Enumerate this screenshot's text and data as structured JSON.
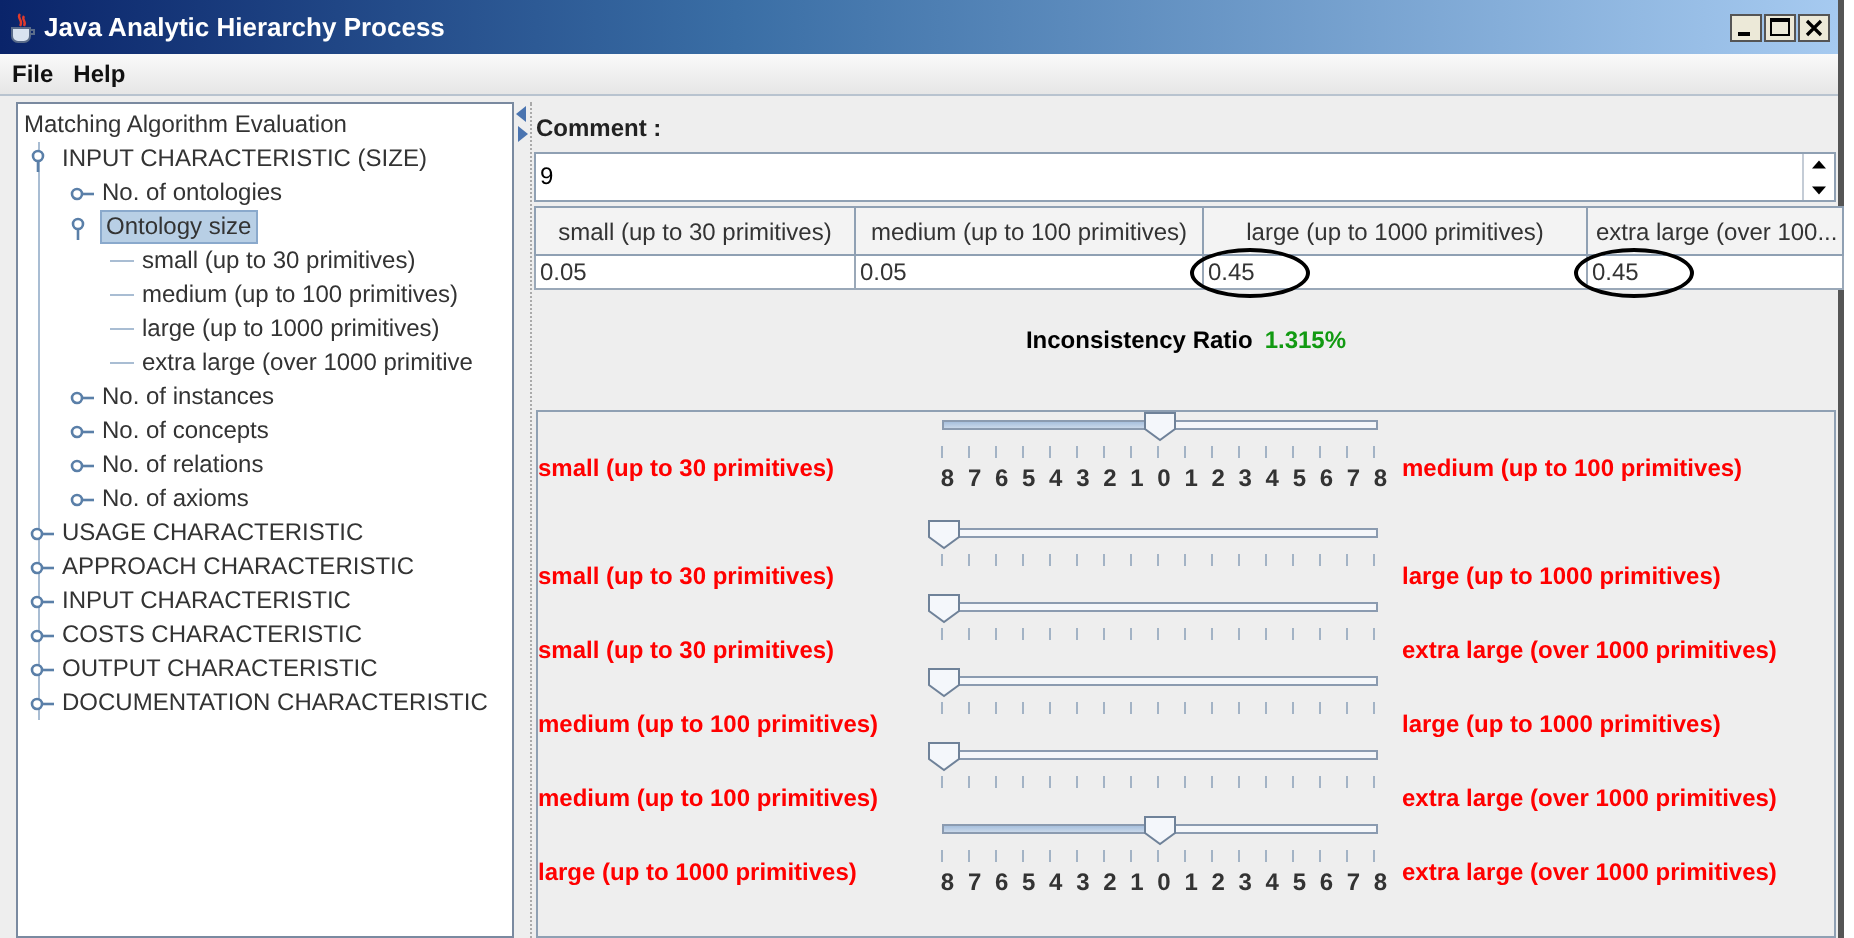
{
  "window": {
    "title": "Java Analytic Hierarchy Process"
  },
  "menu": [
    "File",
    "Help"
  ],
  "tree": {
    "label": "Matching Algorithm Evaluation",
    "children": [
      {
        "label": "INPUT CHARACTERISTIC (SIZE)",
        "expanded": true,
        "selected": false,
        "children": [
          {
            "label": "No. of ontologies",
            "expanded": false,
            "selected": false
          },
          {
            "label": "Ontology size",
            "expanded": true,
            "selected": true,
            "children": [
              {
                "label": "small (up to 30 primitives)",
                "selected": false
              },
              {
                "label": "medium (up to 100 primitives)",
                "selected": false
              },
              {
                "label": "large (up to 1000 primitives)",
                "selected": false
              },
              {
                "label": "extra large (over 1000 primitive",
                "selected": false
              }
            ]
          },
          {
            "label": "No. of instances",
            "expanded": false,
            "selected": false
          },
          {
            "label": "No. of concepts",
            "expanded": false,
            "selected": false
          },
          {
            "label": "No. of relations",
            "expanded": false,
            "selected": false
          },
          {
            "label": "No. of axioms",
            "expanded": false,
            "selected": false
          }
        ]
      },
      {
        "label": "USAGE CHARACTERISTIC",
        "expanded": false,
        "selected": false
      },
      {
        "label": "APPROACH CHARACTERISTIC",
        "expanded": false,
        "selected": false
      },
      {
        "label": "INPUT CHARACTERISTIC",
        "expanded": false,
        "selected": false
      },
      {
        "label": "COSTS CHARACTERISTIC",
        "expanded": false,
        "selected": false
      },
      {
        "label": "OUTPUT CHARACTERISTIC",
        "expanded": false,
        "selected": false
      },
      {
        "label": "DOCUMENTATION CHARACTERISTIC",
        "expanded": false,
        "selected": false
      }
    ]
  },
  "comment": {
    "label": "Comment :",
    "value": "9"
  },
  "weights_table": {
    "columns": [
      "small (up to 30 primitives)",
      "medium (up to 100 primitives)",
      "large (up to 1000 primitives)",
      "extra large (over 100..."
    ],
    "cells": [
      {
        "value": "0.05",
        "circled": false
      },
      {
        "value": "0.05",
        "circled": false
      },
      {
        "value": "0.45",
        "circled": true
      },
      {
        "value": "0.45",
        "circled": true
      }
    ]
  },
  "inconsistency": {
    "label": "Inconsistency Ratio",
    "value": "1.315%"
  },
  "comparisons": [
    {
      "left": "small (up to 30 primitives)",
      "right": "medium (up to 100 primitives)",
      "level": 0.5,
      "tick_labels": [
        "8",
        "7",
        "6",
        "5",
        "4",
        "3",
        "2",
        "1",
        "0",
        "1",
        "2",
        "3",
        "4",
        "5",
        "6",
        "7",
        "8"
      ]
    },
    {
      "left": "small (up to 30 primitives)",
      "right": "large (up to 1000 primitives)",
      "level": 0
    },
    {
      "left": "small (up to 30 primitives)",
      "right": "extra large (over 1000 primitives)",
      "level": 0
    },
    {
      "left": "medium (up to 100 primitives)",
      "right": "large (up to 1000 primitives)",
      "level": 0
    },
    {
      "left": "medium (up to 100 primitives)",
      "right": "extra large (over 1000 primitives)",
      "level": 0
    },
    {
      "left": "large (up to 1000 primitives)",
      "right": "extra large (over 1000 primitives)",
      "level": 0.5,
      "tick_labels": [
        "8",
        "7",
        "6",
        "5",
        "4",
        "3",
        "2",
        "1",
        "0",
        "1",
        "2",
        "3",
        "4",
        "5",
        "6",
        "7",
        "8"
      ]
    }
  ]
}
